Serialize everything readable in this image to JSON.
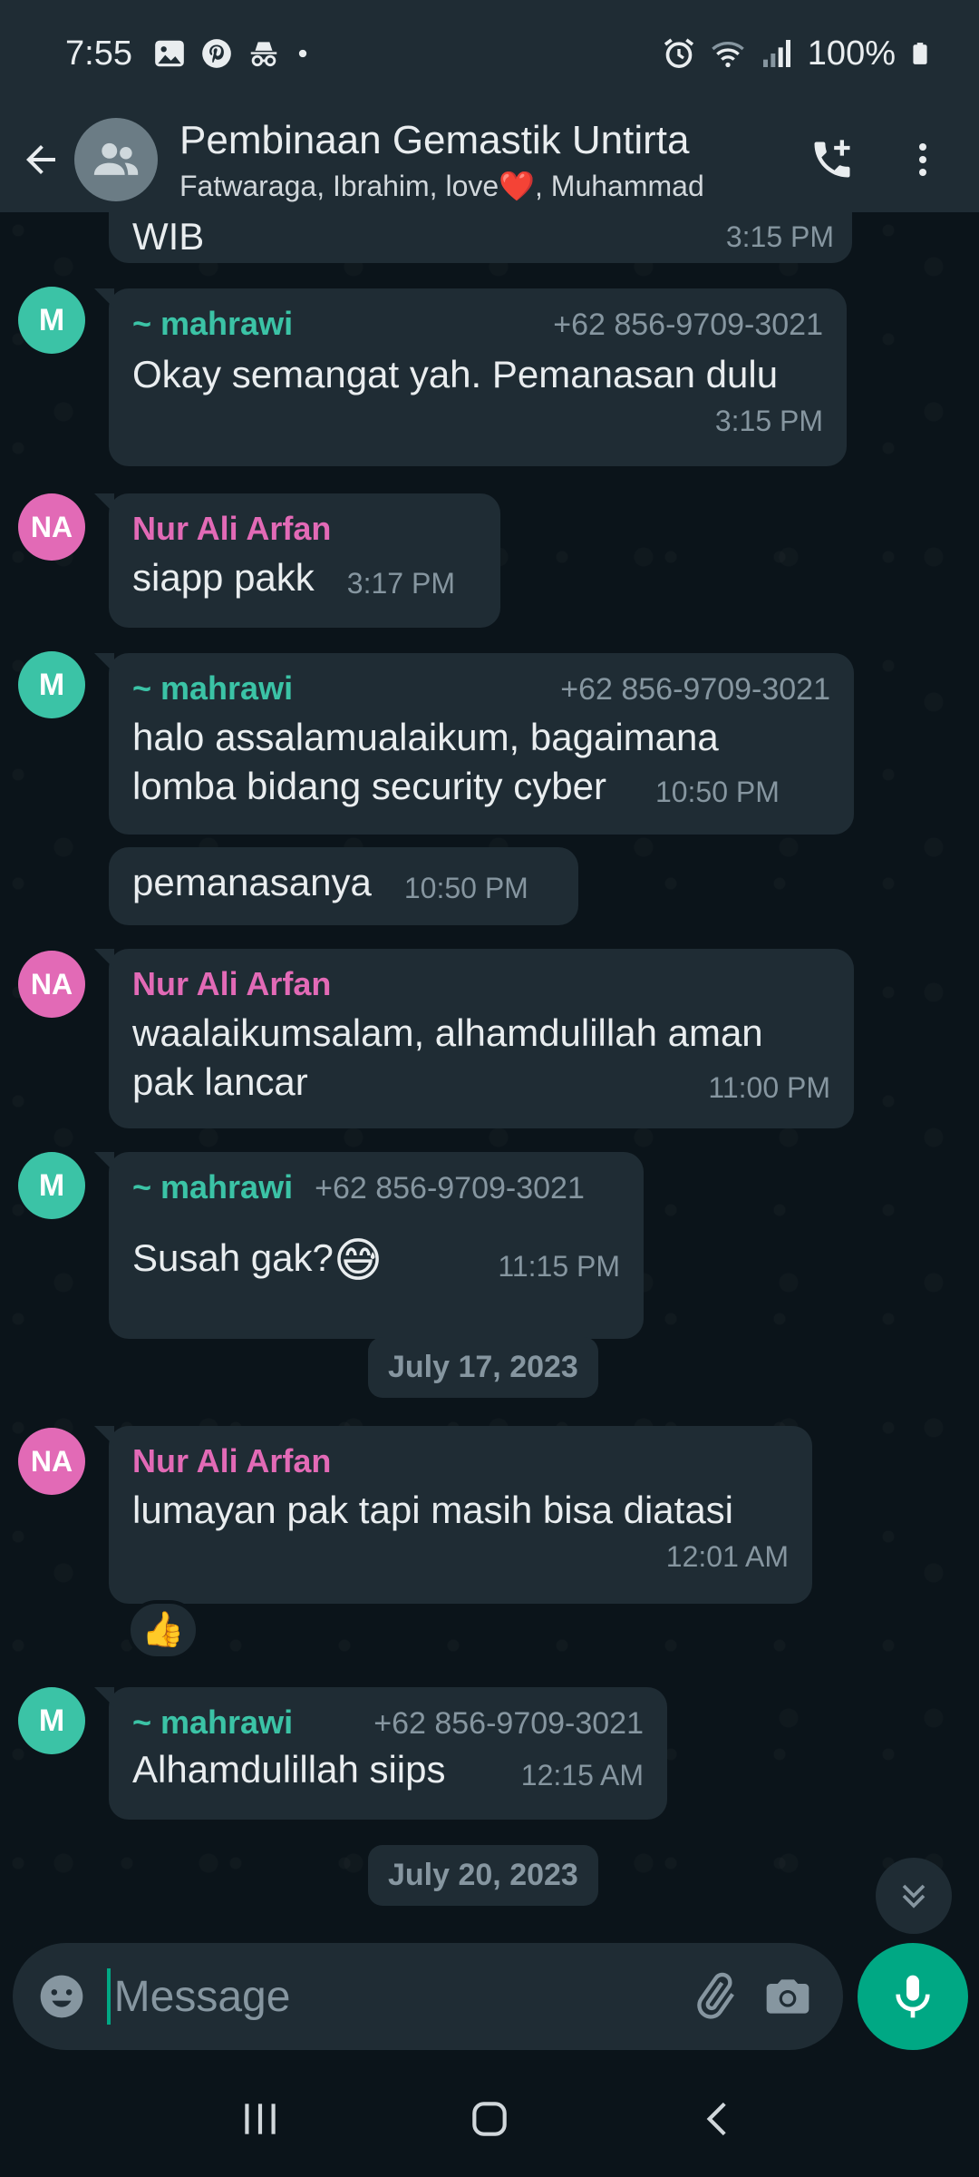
{
  "status_bar": {
    "time": "7:55",
    "battery": "100%",
    "left_icons": [
      "image-icon",
      "pinterest-icon",
      "incognito-icon",
      "dot-icon"
    ],
    "right_icons": [
      "alarm-icon",
      "wifi-icon",
      "signal-icon",
      "battery-icon"
    ]
  },
  "header": {
    "title": "Pembinaan Gemastik Untirta",
    "members": "Fatwaraga, Ibrahim, love❤️, Muhammad"
  },
  "messages": [
    {
      "text": "WIB",
      "time": "3:15 PM"
    },
    {
      "sender": "~ mahrawi",
      "phone": "+62 856-9709-3021",
      "avatar": "M",
      "text": "Okay semangat yah. Pemanasan dulu",
      "time": "3:15 PM"
    },
    {
      "sender": "Nur Ali Arfan",
      "avatar": "NA",
      "text": "siapp pakk",
      "time": "3:17 PM"
    },
    {
      "sender": "~ mahrawi",
      "phone": "+62 856-9709-3021",
      "avatar": "M",
      "text_line1": "halo assalamualaikum, bagaimana",
      "text_line2": "lomba bidang security cyber",
      "time": "10:50 PM"
    },
    {
      "text": "pemanasanya",
      "time": "10:50 PM"
    },
    {
      "sender": "Nur Ali Arfan",
      "avatar": "NA",
      "text_line1": "waalaikumsalam, alhamdulillah aman",
      "text_line2": "pak lancar",
      "time": "11:00 PM"
    },
    {
      "sender": "~ mahrawi",
      "phone": "+62 856-9709-3021",
      "avatar": "M",
      "text": "Susah gak?",
      "emoji": "😅",
      "time": "11:15 PM"
    },
    {
      "sender": "Nur Ali Arfan",
      "avatar": "NA",
      "text": "lumayan pak tapi masih bisa diatasi",
      "time": "12:01 AM",
      "reaction": "👍"
    },
    {
      "sender": "~ mahrawi",
      "phone": "+62 856-9709-3021",
      "avatar": "M",
      "text": "Alhamdulillah siips",
      "time": "12:15 AM"
    }
  ],
  "dates": [
    "July 17, 2023",
    "July 20, 2023"
  ],
  "input": {
    "placeholder": "Message"
  },
  "colors": {
    "accent": "#00a884",
    "teal_name": "#3bc3a6",
    "pink_name": "#e26ab6",
    "bubble": "#1f2c34",
    "background": "#0b141a"
  }
}
